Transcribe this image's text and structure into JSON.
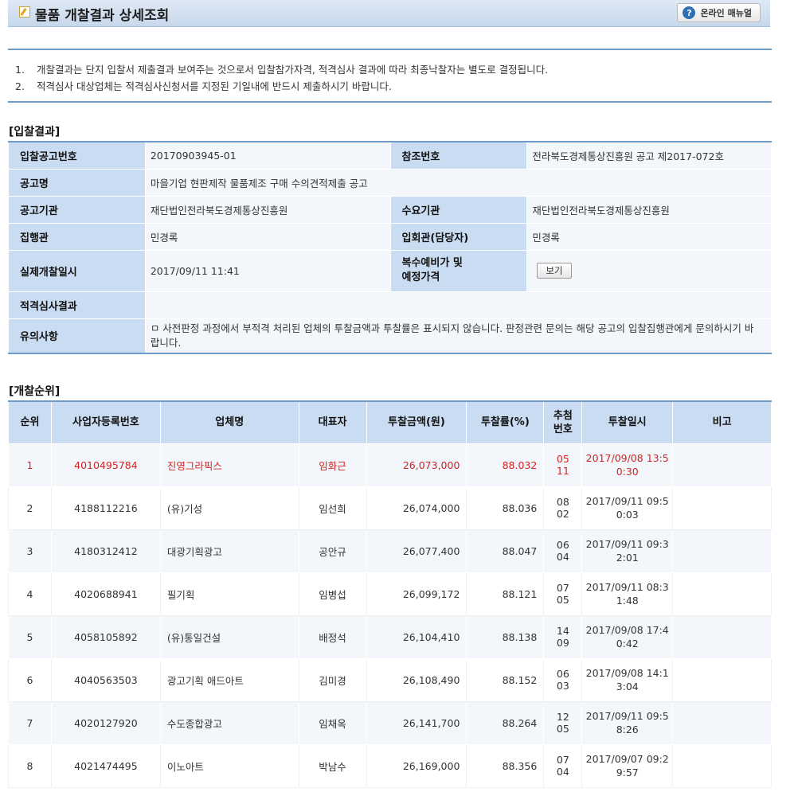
{
  "header": {
    "title": "물품 개찰결과 상세조회",
    "manual_button": "온라인 매뉴얼"
  },
  "notices": [
    {
      "num": "1.",
      "text": "개찰결과는 단지 입찰서 제출결과 보여주는 것으로서 입찰참가자격, 적격심사 결과에 따라 최종낙찰자는 별도로 결정됩니다."
    },
    {
      "num": "2.",
      "text": "적격심사 대상업체는 적격심사신청서를 지정된 기일내에 반드시 제출하시기 바랍니다."
    }
  ],
  "bid_result": {
    "section_title": "[입찰결과]",
    "labels": {
      "notice_no": "입찰공고번호",
      "ref_no": "참조번호",
      "notice_name": "공고명",
      "notice_agency": "공고기관",
      "demand_agency": "수요기관",
      "executor": "집행관",
      "witness": "입회관(담당자)",
      "opening_time": "실제개찰일시",
      "multiple_price": "복수예비가 및\n예정가격",
      "qual_result": "적격심사결과",
      "caution": "유의사항"
    },
    "values": {
      "notice_no": "20170903945-01",
      "ref_no": "전라북도경제통상진흥원 공고 제2017-072호",
      "notice_name": "마을기업 현판제작 물품제조 구매 수의견적제출 공고",
      "notice_agency": "재단법인전라북도경제통상진흥원",
      "demand_agency": "재단법인전라북도경제통상진흥원",
      "executor": "민경록",
      "witness": "민경록",
      "opening_time": "2017/09/11 11:41",
      "view_button": "보기",
      "qual_result": "",
      "caution": "ㅁ 사전판정 과정에서 부적격 처리된 업체의 투찰금액과 투찰률은 표시되지 않습니다. 판정관련 문의는 해당 공고의 입찰집행관에게 문의하시기 바랍니다."
    }
  },
  "ranking": {
    "section_title": "[개찰순위]",
    "columns": [
      "순위",
      "사업자등록번호",
      "업체명",
      "대표자",
      "투찰금액(원)",
      "투찰률(%)",
      "추첨\n번호",
      "투찰일시",
      "비고"
    ],
    "rows": [
      {
        "rank": "1",
        "biz_no": "4010495784",
        "company": "진영그라픽스",
        "ceo": "임화근",
        "amount": "26,073,000",
        "rate": "88.032",
        "draw_no": "05 11",
        "bid_time": "2017/09/08 13:50:30",
        "note": ""
      },
      {
        "rank": "2",
        "biz_no": "4188112216",
        "company": "(유)기성",
        "ceo": "임선희",
        "amount": "26,074,000",
        "rate": "88.036",
        "draw_no": "08 02",
        "bid_time": "2017/09/11 09:50:03",
        "note": ""
      },
      {
        "rank": "3",
        "biz_no": "4180312412",
        "company": "대광기획광고",
        "ceo": "공안규",
        "amount": "26,077,400",
        "rate": "88.047",
        "draw_no": "06 04",
        "bid_time": "2017/09/11 09:32:01",
        "note": ""
      },
      {
        "rank": "4",
        "biz_no": "4020688941",
        "company": "필기획",
        "ceo": "임병섭",
        "amount": "26,099,172",
        "rate": "88.121",
        "draw_no": "07 05",
        "bid_time": "2017/09/11 08:31:48",
        "note": ""
      },
      {
        "rank": "5",
        "biz_no": "4058105892",
        "company": "(유)통일건설",
        "ceo": "배정석",
        "amount": "26,104,410",
        "rate": "88.138",
        "draw_no": "14 09",
        "bid_time": "2017/09/08 17:40:42",
        "note": ""
      },
      {
        "rank": "6",
        "biz_no": "4040563503",
        "company": "광고기획 애드아트",
        "ceo": "김미경",
        "amount": "26,108,490",
        "rate": "88.152",
        "draw_no": "06 03",
        "bid_time": "2017/09/08 14:13:04",
        "note": ""
      },
      {
        "rank": "7",
        "biz_no": "4020127920",
        "company": "수도종합광고",
        "ceo": "임채옥",
        "amount": "26,141,700",
        "rate": "88.264",
        "draw_no": "12 05",
        "bid_time": "2017/09/11 09:58:26",
        "note": ""
      },
      {
        "rank": "8",
        "biz_no": "4021474495",
        "company": "이노아트",
        "ceo": "박남수",
        "amount": "26,169,000",
        "rate": "88.356",
        "draw_no": "07 04",
        "bid_time": "2017/09/07 09:29:57",
        "note": ""
      }
    ]
  }
}
